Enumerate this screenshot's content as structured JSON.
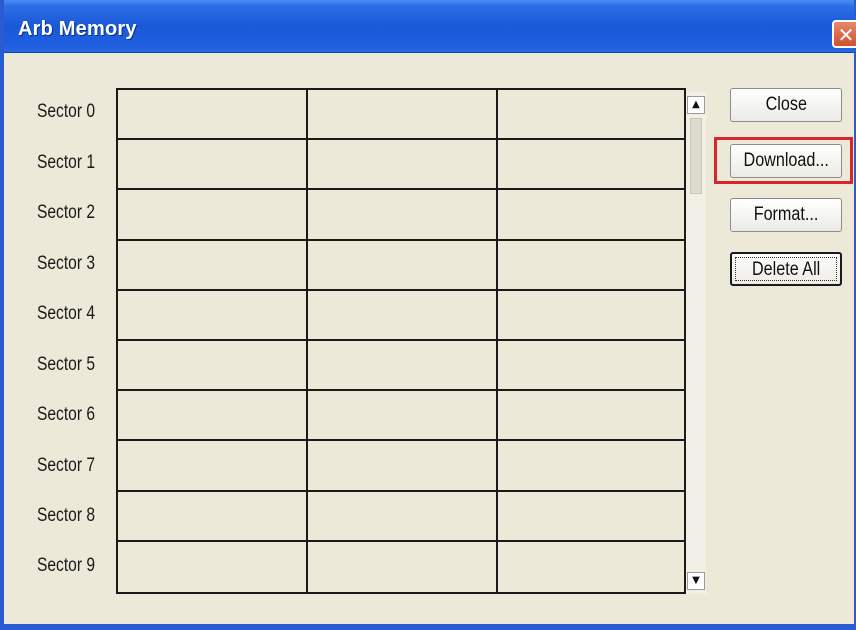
{
  "window": {
    "title": "Arb Memory",
    "close_glyph": "✕"
  },
  "sectors": {
    "labels": [
      "Sector 0",
      "Sector 1",
      "Sector 2",
      "Sector 3",
      "Sector 4",
      "Sector 5",
      "Sector 6",
      "Sector 7",
      "Sector 8",
      "Sector 9"
    ],
    "columns": 3
  },
  "scrollbar": {
    "up_arrow": "▲",
    "down_arrow": "▼"
  },
  "buttons": {
    "close_label": "Close",
    "download_label": "Download...",
    "format_label": "Format...",
    "delete_all_label": "Delete All"
  },
  "highlight": {
    "target": "download-button",
    "color": "#d8262e"
  },
  "colors": {
    "titlebar": "#1a58d8",
    "dialog_bg": "#ece9d8"
  }
}
